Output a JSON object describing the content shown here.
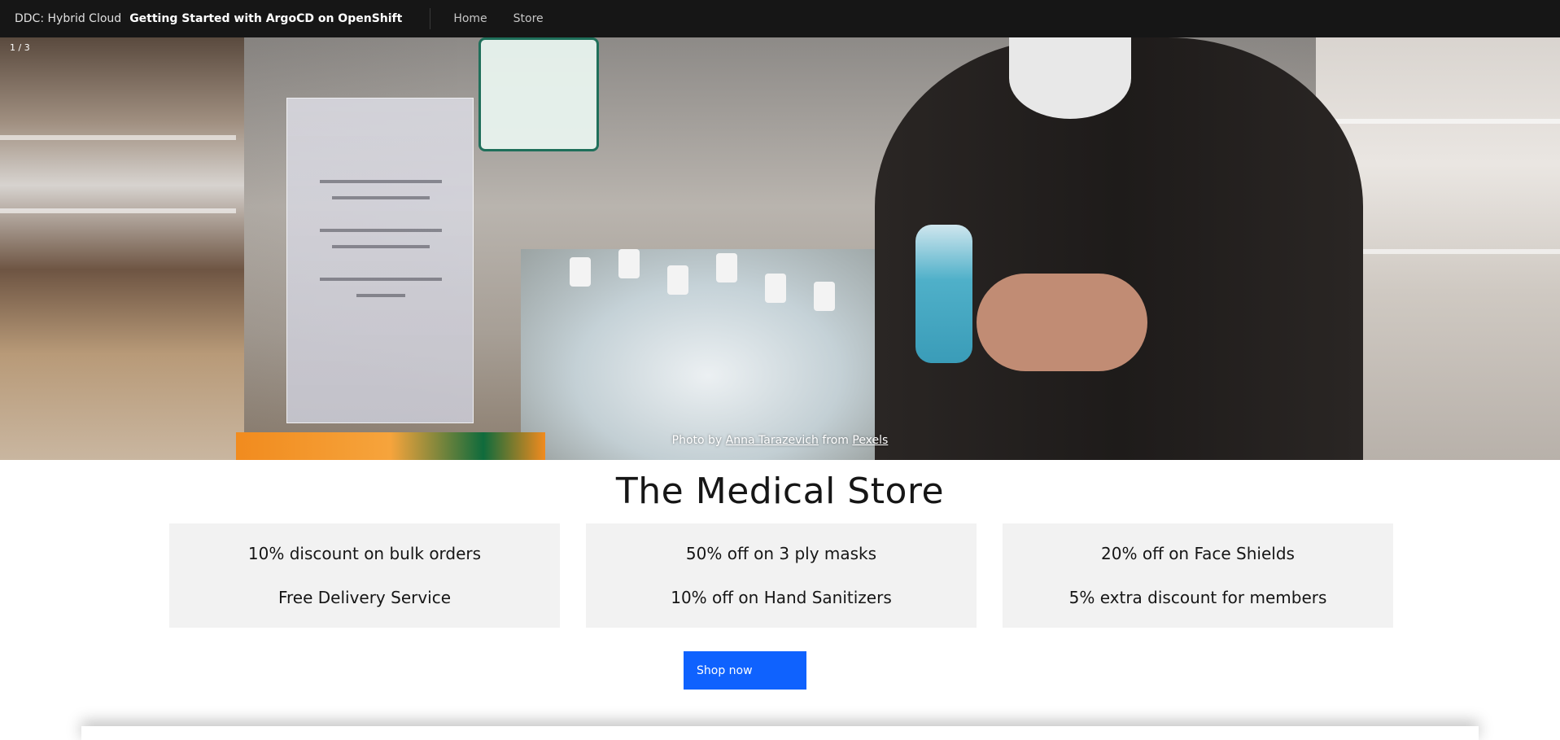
{
  "header": {
    "brand_prefix": "DDC: Hybrid Cloud",
    "brand_name": "Getting Started with ArgoCD on OpenShift",
    "nav": [
      {
        "label": "Home"
      },
      {
        "label": "Store"
      }
    ]
  },
  "hero": {
    "slide_counter": "1 / 3",
    "credit_prefix": "Photo by",
    "credit_author": "Anna Tarazevich",
    "credit_middle": "from",
    "credit_source": "Pexels"
  },
  "main": {
    "title": "The Medical Store",
    "offers": [
      {
        "line1": "10% discount on bulk orders",
        "line2": "Free Delivery Service"
      },
      {
        "line1": "50% off on 3 ply masks",
        "line2": "10% off on Hand Sanitizers"
      },
      {
        "line1": "20% off on Face Shields",
        "line2": "5% extra discount for members"
      }
    ],
    "shop_button": "Shop now"
  },
  "colors": {
    "header_bg": "#161616",
    "primary_button": "#0f62fe",
    "card_bg": "#f2f2f2"
  }
}
